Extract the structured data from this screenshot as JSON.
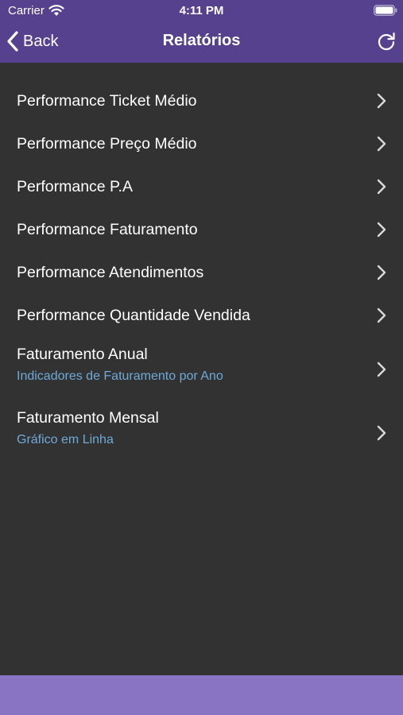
{
  "status_bar": {
    "carrier": "Carrier",
    "time": "4:11 PM"
  },
  "nav": {
    "back_label": "Back",
    "title": "Relatórios"
  },
  "rows": [
    {
      "title": "Performance Ticket Médio"
    },
    {
      "title": "Performance Preço Médio"
    },
    {
      "title": "Performance P.A"
    },
    {
      "title": "Performance Faturamento"
    },
    {
      "title": "Performance Atendimentos"
    },
    {
      "title": "Performance Quantidade Vendida"
    },
    {
      "title": "Faturamento Anual",
      "subtitle": "Indicadores de Faturamento por Ano"
    },
    {
      "title": "Faturamento Mensal",
      "subtitle": "Gráfico em Linha"
    }
  ],
  "colors": {
    "nav_background": "#56418f",
    "list_background": "#323232",
    "subtitle_text": "#6eaad8",
    "bottom_bar": "#8974c4"
  },
  "icons": {
    "back": "chevron-left-icon",
    "refresh": "refresh-icon",
    "row_disclosure": "chevron-right-icon",
    "wifi": "wifi-icon",
    "battery": "battery-icon"
  }
}
